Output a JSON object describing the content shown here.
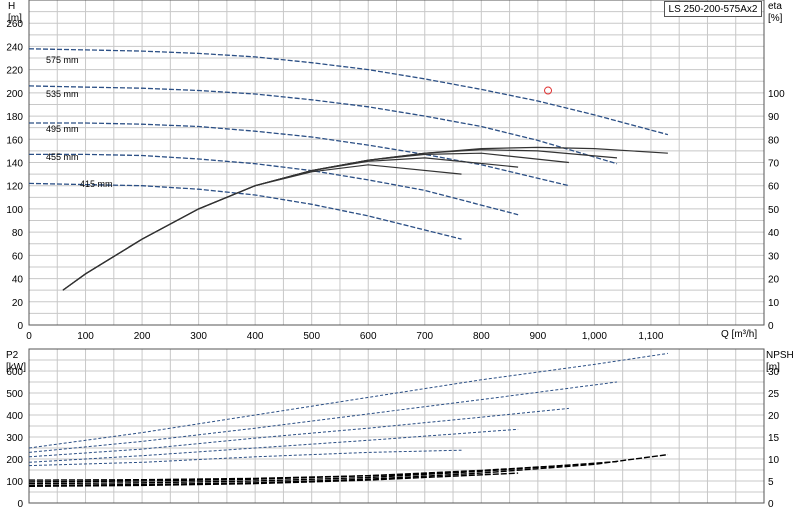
{
  "title": "LS 250-200-575Ax2",
  "colors": {
    "head": "#2b4f85",
    "eff": "#333333",
    "power": "#2b4f85",
    "npsh": "#000000",
    "grid": "#c8c8c8",
    "marker": "#e03030"
  },
  "chart_data": [
    {
      "type": "line",
      "ylabel_left": [
        "H",
        "[m]"
      ],
      "ylabel_right": [
        "eta",
        "[%]"
      ],
      "xlabel": "Q [m³/h]",
      "xlim": [
        0,
        1300
      ],
      "ylim": [
        0,
        280
      ],
      "eta_lim": [
        0,
        140
      ],
      "xticks": [
        "0",
        "100",
        "200",
        "300",
        "400",
        "500",
        "600",
        "700",
        "800",
        "900",
        "1,000",
        "1,100"
      ],
      "yticks": [
        "0",
        "20",
        "40",
        "60",
        "80",
        "100",
        "120",
        "140",
        "160",
        "180",
        "200",
        "220",
        "240",
        "260"
      ],
      "eta_ticks": [
        "0",
        "10",
        "20",
        "30",
        "40",
        "50",
        "60",
        "70",
        "80",
        "90",
        "100"
      ],
      "grid": true,
      "head_series": [
        {
          "name": "575 mm",
          "x": [
            0,
            100,
            200,
            300,
            400,
            500,
            600,
            700,
            800,
            900,
            1000,
            1130
          ],
          "y": [
            238,
            237,
            236,
            234,
            231,
            226,
            220,
            212,
            203,
            193,
            181,
            164
          ]
        },
        {
          "name": "535 mm",
          "x": [
            0,
            100,
            200,
            300,
            400,
            500,
            600,
            700,
            800,
            900,
            1040
          ],
          "y": [
            206,
            205,
            204,
            202,
            199,
            194,
            188,
            180,
            171,
            159,
            139
          ]
        },
        {
          "name": "495 mm",
          "x": [
            0,
            100,
            200,
            300,
            400,
            500,
            600,
            700,
            800,
            955
          ],
          "y": [
            174,
            174,
            173,
            171,
            167,
            162,
            155,
            147,
            138,
            120
          ]
        },
        {
          "name": "455 mm",
          "x": [
            0,
            100,
            200,
            300,
            400,
            500,
            600,
            700,
            865
          ],
          "y": [
            147,
            147,
            146,
            143,
            139,
            133,
            125,
            116,
            95
          ]
        },
        {
          "name": "415 mm",
          "x": [
            0,
            100,
            200,
            300,
            400,
            500,
            600,
            765
          ],
          "y": [
            122,
            121,
            120,
            117,
            112,
            104,
            94,
            74
          ]
        }
      ],
      "eff_series": [
        {
          "x": [
            60,
            100,
            200,
            300,
            400,
            500,
            600,
            700,
            800,
            900,
            1000,
            1130
          ],
          "y": [
            15,
            22,
            37,
            50,
            60,
            66.5,
            71,
            74,
            76,
            76.5,
            76,
            74
          ]
        },
        {
          "x": [
            60,
            100,
            200,
            300,
            400,
            500,
            600,
            700,
            800,
            900,
            1040
          ],
          "y": [
            15,
            22,
            37,
            50,
            60,
            66.5,
            71,
            74,
            75.5,
            75,
            72
          ]
        },
        {
          "x": [
            60,
            100,
            200,
            300,
            400,
            500,
            600,
            700,
            800,
            955
          ],
          "y": [
            15,
            22,
            37,
            50,
            60,
            66.5,
            71,
            73.5,
            74,
            70
          ]
        },
        {
          "x": [
            60,
            100,
            200,
            300,
            400,
            500,
            600,
            700,
            865
          ],
          "y": [
            15,
            22,
            37,
            50,
            60,
            66.5,
            70.5,
            72,
            68
          ]
        },
        {
          "x": [
            60,
            100,
            200,
            300,
            400,
            500,
            600,
            765
          ],
          "y": [
            15,
            22,
            37,
            50,
            60,
            66,
            69,
            65
          ]
        }
      ],
      "marker": {
        "x": 918,
        "y": 202
      }
    },
    {
      "type": "line",
      "ylabel_left": [
        "P2",
        "[kW]"
      ],
      "ylabel_right": [
        "NPSH",
        "[m]"
      ],
      "xlim": [
        0,
        1300
      ],
      "ylim": [
        0,
        700
      ],
      "npsh_lim": [
        0,
        35
      ],
      "yticks": [
        "0",
        "100",
        "200",
        "300",
        "400",
        "500",
        "600"
      ],
      "npsh_ticks": [
        "0",
        "5",
        "10",
        "15",
        "20",
        "25",
        "30"
      ],
      "grid": true,
      "power_series": [
        {
          "name": "575 mm",
          "x": [
            0,
            200,
            400,
            600,
            800,
            1000,
            1130
          ],
          "y": [
            250,
            320,
            400,
            480,
            560,
            630,
            680
          ]
        },
        {
          "name": "535 mm",
          "x": [
            0,
            200,
            400,
            600,
            800,
            1040
          ],
          "y": [
            230,
            280,
            340,
            405,
            470,
            550
          ]
        },
        {
          "name": "495 mm",
          "x": [
            0,
            200,
            400,
            600,
            800,
            955
          ],
          "y": [
            210,
            245,
            295,
            340,
            390,
            430
          ]
        },
        {
          "name": "455 mm",
          "x": [
            0,
            200,
            400,
            600,
            865
          ],
          "y": [
            185,
            215,
            250,
            285,
            335
          ]
        },
        {
          "name": "415 mm",
          "x": [
            0,
            200,
            400,
            600,
            765
          ],
          "y": [
            170,
            185,
            210,
            230,
            240
          ]
        }
      ],
      "npsh_series": [
        {
          "x": [
            0,
            200,
            400,
            600,
            800,
            1000,
            1130
          ],
          "y": [
            4,
            4.2,
            4.6,
            5.4,
            6.8,
            8.8,
            11
          ]
        },
        {
          "x": [
            0,
            200,
            400,
            600,
            800,
            1040
          ],
          "y": [
            4.4,
            4.6,
            5,
            5.8,
            7.2,
            9.4
          ]
        },
        {
          "x": [
            0,
            200,
            400,
            600,
            800,
            955
          ],
          "y": [
            4.8,
            5,
            5.4,
            6.2,
            7.4,
            8.6
          ]
        },
        {
          "x": [
            0,
            200,
            400,
            600,
            865
          ],
          "y": [
            3.8,
            4,
            4.4,
            5.2,
            6.8
          ]
        },
        {
          "x": [
            0,
            200,
            400,
            600,
            765
          ],
          "y": [
            5.2,
            5.3,
            5.6,
            6.2,
            6.9
          ]
        }
      ]
    }
  ]
}
